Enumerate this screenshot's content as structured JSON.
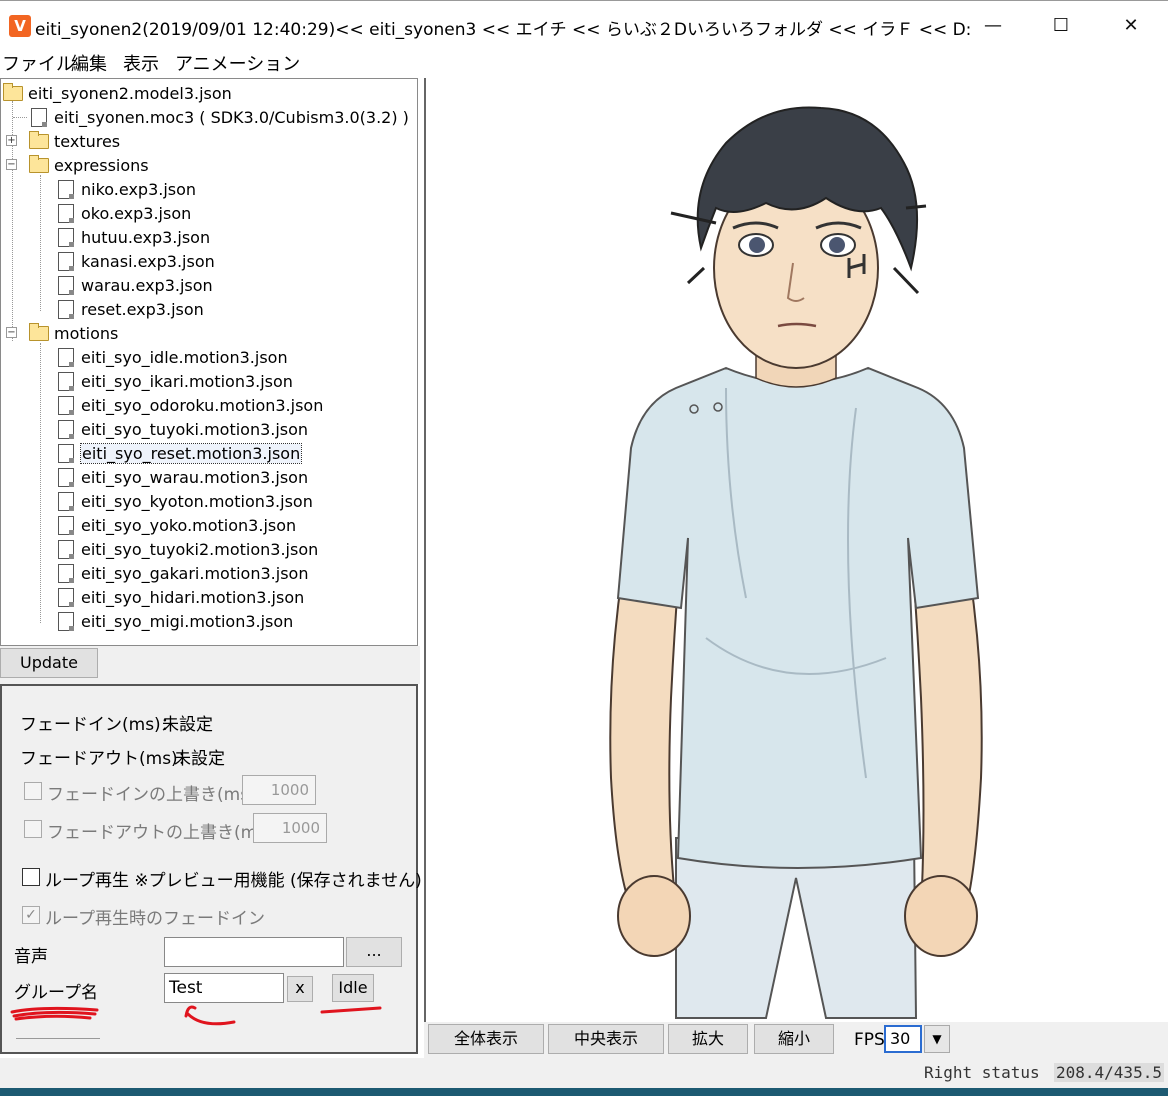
{
  "window": {
    "title": "eiti_syonen2(2019/09/01 12:40:29)<< eiti_syonen3 << エイチ << らいぶ２Dいろいろフォルダ << イラＦ << D:",
    "icon_letter": "V",
    "minimize": "—",
    "maximize": "☐",
    "close": "✕"
  },
  "menu": [
    "ファイル",
    "編集",
    "表示",
    "アニメーション"
  ],
  "tree": {
    "root": "eiti_syonen2.model3.json",
    "moc": "eiti_syonen.moc3 ( SDK3.0/Cubism3.0(3.2) )",
    "textures": "textures",
    "expressions_label": "expressions",
    "expressions": [
      "niko.exp3.json",
      "oko.exp3.json",
      "hutuu.exp3.json",
      "kanasi.exp3.json",
      "warau.exp3.json",
      "reset.exp3.json"
    ],
    "motions_label": "motions",
    "motions": [
      "eiti_syo_idle.motion3.json",
      "eiti_syo_ikari.motion3.json",
      "eiti_syo_odoroku.motion3.json",
      "eiti_syo_tuyoki.motion3.json",
      "eiti_syo_reset.motion3.json",
      "eiti_syo_warau.motion3.json",
      "eiti_syo_kyoton.motion3.json",
      "eiti_syo_yoko.motion3.json",
      "eiti_syo_tuyoki2.motion3.json",
      "eiti_syo_gakari.motion3.json",
      "eiti_syo_hidari.motion3.json",
      "eiti_syo_migi.motion3.json"
    ],
    "selected_motion": "eiti_syo_reset.motion3.json"
  },
  "update_button": "Update",
  "props": {
    "fadein_label": "フェードイン(ms)：",
    "fadein_value": "未設定",
    "fadeout_label": "フェードアウト(ms)：",
    "fadeout_value": "未設定",
    "override_fadein_label": "フェードインの上書き(ms)",
    "override_fadein_value": "1000",
    "override_fadeout_label": "フェードアウトの上書き(ms)",
    "override_fadeout_value": "1000",
    "loop_label": "ループ再生 ※プレビュー用機能 (保存されません)",
    "loop_fadein_label": "ループ再生時のフェードイン",
    "loop_fadein_check": "✓",
    "sound_label": "音声",
    "sound_value": "",
    "browse_button": "...",
    "group_label": "グループ名",
    "group_value": "Test",
    "clear_button": "x",
    "idle_button": "Idle"
  },
  "preview_toolbar": {
    "fit_all": "全体表示",
    "center": "中央表示",
    "zoom_in": "拡大",
    "zoom_out": "縮小",
    "fps_label": "FPS",
    "fps_value": "30",
    "dropdown_arrow": "▼"
  },
  "status": {
    "right_status": "Right status",
    "coords": "208.4/435.5"
  },
  "colors": {
    "annotation_red": "#e0141e",
    "status_strip": "#1d5a72"
  }
}
